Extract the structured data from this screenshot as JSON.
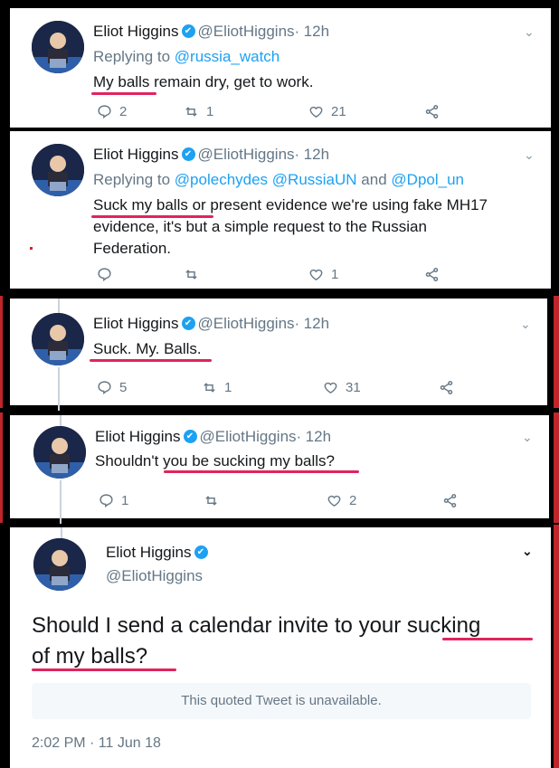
{
  "tweets": [
    {
      "name": "Eliot Higgins",
      "handle": "@EliotHiggins",
      "time": "12h",
      "reply_prefix": "Replying to",
      "reply_to": "@russia_watch",
      "text": "My balls remain dry, get to work.",
      "replies": "2",
      "retweets": "1",
      "likes": "21"
    },
    {
      "name": "Eliot Higgins",
      "handle": "@EliotHiggins",
      "time": "12h",
      "reply_prefix": "Replying to",
      "reply_to": "@polechydes @RussiaUN",
      "reply_and": "and",
      "reply_to_2": "@Dpol_un",
      "text_line1": "Suck my balls or present evidence we're using fake MH17",
      "text_line2": "evidence, it's but a simple request to the Russian",
      "text_line3": "Federation.",
      "replies": "",
      "retweets": "",
      "likes": "1"
    },
    {
      "name": "Eliot Higgins",
      "handle": "@EliotHiggins",
      "time": "12h",
      "text": "Suck. My. Balls.",
      "replies": "5",
      "retweets": "1",
      "likes": "31"
    },
    {
      "name": "Eliot Higgins",
      "handle": "@EliotHiggins",
      "time": "12h",
      "text": "Shouldn't you be sucking my balls?",
      "replies": "1",
      "retweets": "",
      "likes": "2"
    }
  ],
  "main_tweet": {
    "name": "Eliot Higgins",
    "handle": "@EliotHiggins",
    "text_line1": "Should I send a calendar invite to your sucking",
    "text_line2": "of my balls?",
    "quoted_unavailable": "This quoted Tweet is unavailable.",
    "timestamp": "2:02 PM · 11 Jun 18"
  },
  "separator": "·",
  "colors": {
    "accent": "#1da1f2",
    "underline": "#e0245e",
    "muted": "#657786"
  }
}
